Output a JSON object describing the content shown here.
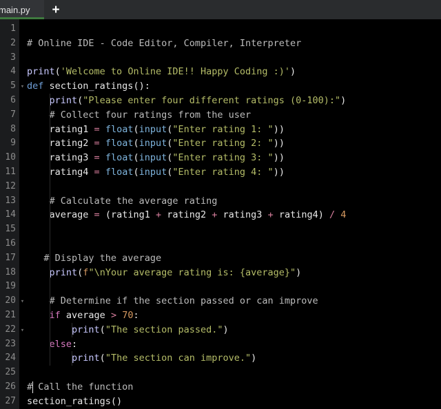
{
  "window": {
    "theme": "dark",
    "accent_green": "#3f7a3f",
    "background": "#000000",
    "gutter_background": "#1b1c1e",
    "tabbar_background": "#2a2c2e"
  },
  "tabbar": {
    "active_tab_label": "main.py",
    "new_tab_label": "+"
  },
  "editor": {
    "language": "python",
    "cursor_line": 25,
    "cursor_column": 2,
    "total_lines": 27,
    "fold_markers": [
      5,
      20,
      22
    ],
    "line_numbers": [
      "1",
      "2",
      "3",
      "4",
      "5",
      "6",
      "7",
      "8",
      "9",
      "10",
      "11",
      "12",
      "13",
      "14",
      "15",
      "16",
      "17",
      "18",
      "19",
      "20",
      "21",
      "22",
      "23",
      "24",
      "25",
      "26",
      "27"
    ],
    "lines": [
      {
        "n": 1,
        "text": ""
      },
      {
        "n": 2,
        "text": "# Online IDE - Code Editor, Compiler, Interpreter"
      },
      {
        "n": 3,
        "text": ""
      },
      {
        "n": 4,
        "text": "print('Welcome to Online IDE!! Happy Coding :)')"
      },
      {
        "n": 5,
        "text": "def section_ratings():"
      },
      {
        "n": 6,
        "text": "    print(\"Please enter four different ratings (0-100):\")"
      },
      {
        "n": 7,
        "text": "    # Collect four ratings from the user"
      },
      {
        "n": 8,
        "text": "    rating1 = float(input(\"Enter rating 1: \"))"
      },
      {
        "n": 9,
        "text": "    rating2 = float(input(\"Enter rating 2: \"))"
      },
      {
        "n": 10,
        "text": "    rating3 = float(input(\"Enter rating 3: \"))"
      },
      {
        "n": 11,
        "text": "    rating4 = float(input(\"Enter rating 4: \"))"
      },
      {
        "n": 12,
        "text": ""
      },
      {
        "n": 13,
        "text": "    # Calculate the average rating"
      },
      {
        "n": 14,
        "text": "    average = (rating1 + rating2 + rating3 + rating4) / 4"
      },
      {
        "n": 15,
        "text": ""
      },
      {
        "n": 16,
        "text": ""
      },
      {
        "n": 17,
        "text": "   # Display the average"
      },
      {
        "n": 18,
        "text": "    print(f\"\\nYour average rating is: {average}\")"
      },
      {
        "n": 19,
        "text": ""
      },
      {
        "n": 20,
        "text": "    # Determine if the section passed or can improve"
      },
      {
        "n": 21,
        "text": "    if average > 70:"
      },
      {
        "n": 22,
        "text": "        print(\"The section passed.\")"
      },
      {
        "n": 23,
        "text": "    else:"
      },
      {
        "n": 24,
        "text": "        print(\"The section can improve.\")"
      },
      {
        "n": 25,
        "text": ""
      },
      {
        "n": 26,
        "text": "# Call the function"
      },
      {
        "n": 27,
        "text": "section_ratings()"
      }
    ],
    "tokens": {
      "line2": {
        "comment": "# Online IDE - Code Editor, Compiler, Interpreter"
      },
      "line4": {
        "fn": "print",
        "p1": "(",
        "str": "'Welcome to Online IDE!! Happy Coding :)'",
        "p2": ")"
      },
      "line5": {
        "kw": "def",
        "name": " section_ratings",
        "p": "():"
      },
      "line6": {
        "indent": "    ",
        "fn": "print",
        "p1": "(",
        "str": "\"Please enter four different ratings (0-100):\"",
        "p2": ")"
      },
      "line7": {
        "indent": "    ",
        "comment": "# Collect four ratings from the user"
      },
      "line8": {
        "indent": "    ",
        "var": "rating1 ",
        "op": "= ",
        "bi1": "float",
        "p1": "(",
        "bi2": "input",
        "p2": "(",
        "str": "\"Enter rating 1: \"",
        "p3": "))"
      },
      "line9": {
        "indent": "    ",
        "var": "rating2 ",
        "op": "= ",
        "bi1": "float",
        "p1": "(",
        "bi2": "input",
        "p2": "(",
        "str": "\"Enter rating 2: \"",
        "p3": "))"
      },
      "line10": {
        "indent": "    ",
        "var": "rating3 ",
        "op": "= ",
        "bi1": "float",
        "p1": "(",
        "bi2": "input",
        "p2": "(",
        "str": "\"Enter rating 3: \"",
        "p3": "))"
      },
      "line11": {
        "indent": "    ",
        "var": "rating4 ",
        "op": "= ",
        "bi1": "float",
        "p1": "(",
        "bi2": "input",
        "p2": "(",
        "str": "\"Enter rating 4: \"",
        "p3": "))"
      },
      "line13": {
        "indent": "    ",
        "comment": "# Calculate the average rating"
      },
      "line14": {
        "indent": "    ",
        "var": "average ",
        "eq": "= ",
        "expr": "(rating1 ",
        "plus1": "+",
        "r2": " rating2 ",
        "plus2": "+",
        "r3": " rating3 ",
        "plus3": "+",
        "r4": " rating4) ",
        "slash": "/",
        "num": " 4"
      },
      "line17": {
        "indent": "   ",
        "comment": "# Display the average"
      },
      "line18": {
        "indent": "    ",
        "fn": "print",
        "p1": "(",
        "pre": "f",
        "str": "\"\\nYour average rating is: {average}\"",
        "p2": ")"
      },
      "line20": {
        "indent": "    ",
        "comment": "# Determine if the section passed or can improve"
      },
      "line21": {
        "indent": "    ",
        "kw": "if",
        "var": " average ",
        "op": ">",
        "num": " 70",
        "p": ":"
      },
      "line22": {
        "indent": "        ",
        "fn": "print",
        "p1": "(",
        "str": "\"The section passed.\"",
        "p2": ")"
      },
      "line23": {
        "indent": "    ",
        "kw": "else",
        "p": ":"
      },
      "line24": {
        "indent": "        ",
        "fn": "print",
        "p1": "(",
        "str": "\"The section can improve.\"",
        "p2": ")"
      },
      "line26": {
        "comment": "# Call the function"
      },
      "line27": {
        "name": "section_ratings",
        "p": "()"
      }
    },
    "fold_glyph": "▾"
  }
}
